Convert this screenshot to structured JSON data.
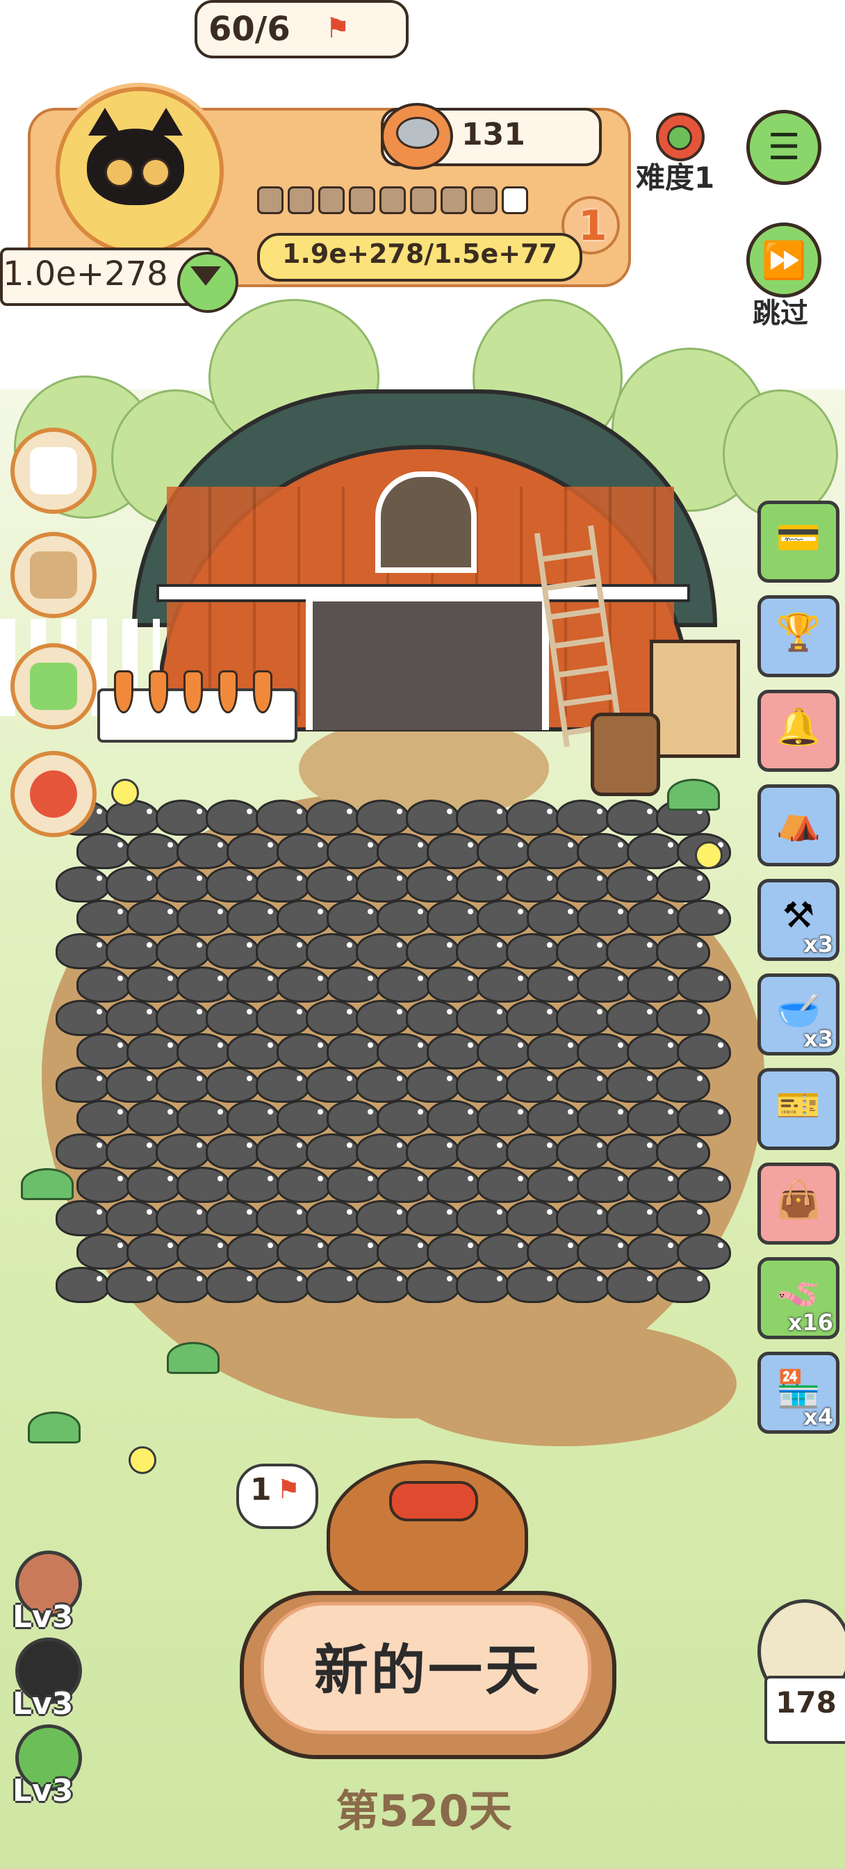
{
  "hud": {
    "flag_progress": "60/6",
    "coins": "131",
    "progress_segments_filled": 8,
    "progress_segments_total": 9,
    "level": "1",
    "exp_text": "1.9e+278/1.5e+77",
    "gold": "1.0e+278"
  },
  "top_right": {
    "difficulty_label": "难度1",
    "skip_label": "跳过"
  },
  "right_items": [
    {
      "name": "card",
      "glyph": "💳",
      "count": "",
      "color": "#8ed36a"
    },
    {
      "name": "trophy",
      "glyph": "🏆",
      "count": "",
      "color": "#9fc6f0"
    },
    {
      "name": "bell",
      "glyph": "🔔",
      "count": "",
      "color": "#f4a3a0"
    },
    {
      "name": "stall",
      "glyph": "⛺",
      "count": "",
      "color": "#9fc6f0"
    },
    {
      "name": "sickle",
      "glyph": "⚒",
      "count": "x3",
      "color": "#9fc6f0"
    },
    {
      "name": "bowl",
      "glyph": "🥣",
      "count": "x3",
      "color": "#9fc6f0"
    },
    {
      "name": "ticket",
      "glyph": "🎫",
      "count": "",
      "color": "#9fc6f0"
    },
    {
      "name": "bag",
      "glyph": "👜",
      "count": "",
      "color": "#f4a3a0"
    },
    {
      "name": "worms",
      "glyph": "🪱",
      "count": "x16",
      "color": "#8ed36a"
    },
    {
      "name": "shop",
      "glyph": "🏪",
      "count": "x4",
      "color": "#9fc6f0"
    }
  ],
  "bottom": {
    "flag_bubble": "1",
    "new_day_button": "新的一天",
    "day_label": "第520天",
    "owl_count": "178",
    "levels": [
      "Lv3",
      "Lv3",
      "Lv3"
    ]
  },
  "colors": {
    "accent_orange": "#f6c07f",
    "accent_green": "#8bd66a",
    "dirt": "#c9a06a",
    "mole": "#585858"
  }
}
